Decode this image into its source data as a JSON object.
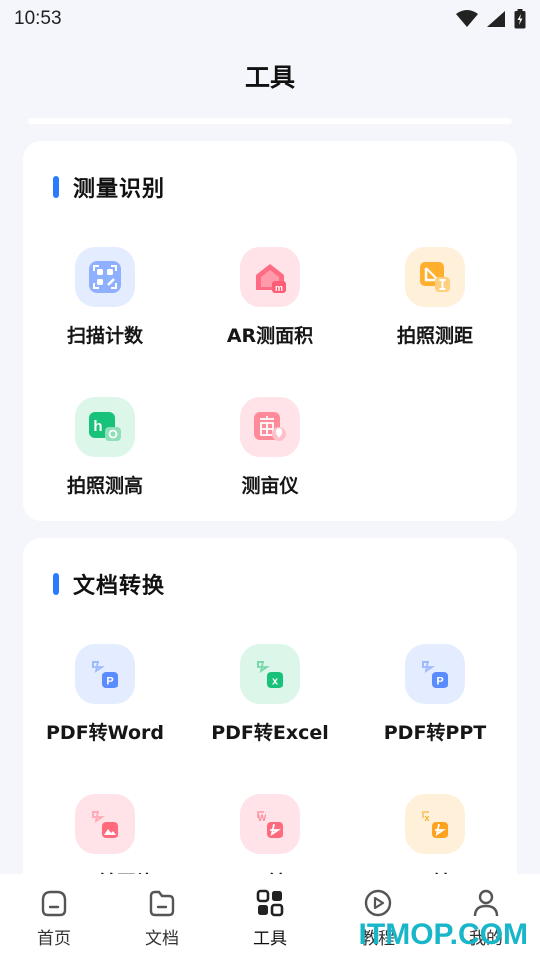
{
  "status_bar": {
    "time": "10:53"
  },
  "header": {
    "title": "工具"
  },
  "sections": [
    {
      "title": "测量识别",
      "tools": [
        {
          "label": "扫描计数",
          "icon": "scan-count-icon",
          "color": "#5b8cff"
        },
        {
          "label": "AR测面积",
          "icon": "ar-area-icon",
          "color": "#ff5c75"
        },
        {
          "label": "拍照测距",
          "icon": "photo-distance-icon",
          "color": "#ffa21f"
        },
        {
          "label": "拍照测高",
          "icon": "photo-height-icon",
          "color": "#19c27a"
        },
        {
          "label": "测亩仪",
          "icon": "acre-meter-icon",
          "color": "#ff6b7d"
        }
      ]
    },
    {
      "title": "文档转换",
      "tools": [
        {
          "label": "PDF转Word",
          "icon": "pdf-to-word-icon",
          "color": "#5b8cff"
        },
        {
          "label": "PDF转Excel",
          "icon": "pdf-to-excel-icon",
          "color": "#19c27a"
        },
        {
          "label": "PDF转PPT",
          "icon": "pdf-to-ppt-icon",
          "color": "#5b8cff"
        },
        {
          "label": "PDF转图片",
          "icon": "pdf-to-image-icon",
          "color": "#ff6b7d"
        },
        {
          "label": "Word转PDF",
          "icon": "word-to-pdf-icon",
          "color": "#ff6b7d"
        },
        {
          "label": "Excel转PDF",
          "icon": "excel-to-pdf-icon",
          "color": "#ffa21f"
        }
      ]
    }
  ],
  "tabbar": [
    {
      "label": "首页",
      "icon": "home-icon",
      "active": false
    },
    {
      "label": "文档",
      "icon": "folder-icon",
      "active": false
    },
    {
      "label": "工具",
      "icon": "grid-icon",
      "active": true
    },
    {
      "label": "教程",
      "icon": "play-icon",
      "active": false
    },
    {
      "label": "我的",
      "icon": "user-icon",
      "active": false
    }
  ],
  "watermark": "ITMOP.COM",
  "colors": {
    "accent": "#2b7bff",
    "background": "#f4f6fb"
  }
}
